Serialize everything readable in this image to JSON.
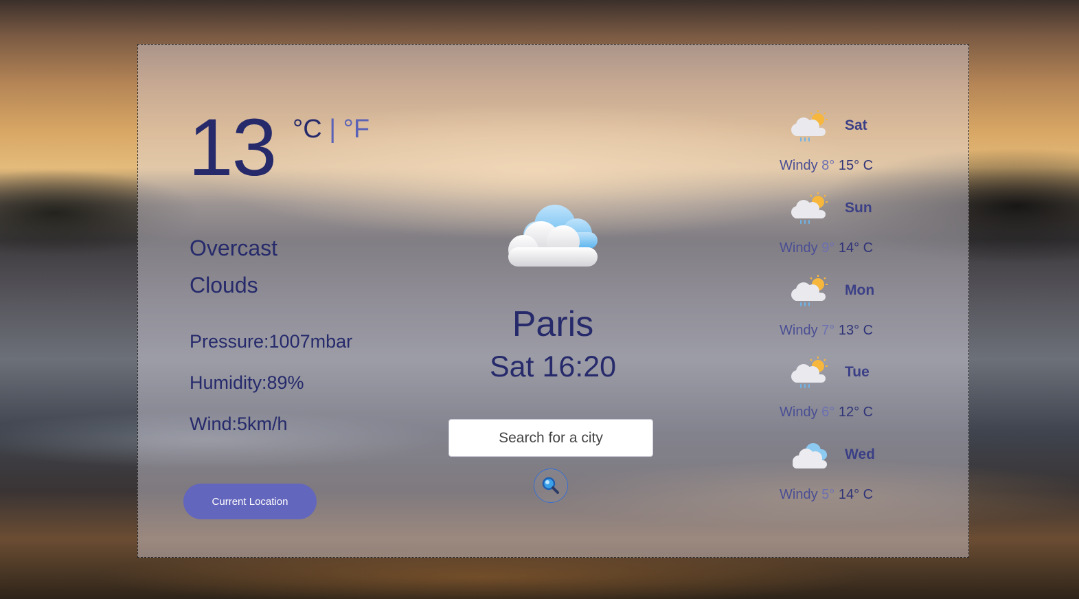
{
  "current": {
    "temperature": "13",
    "unit_celsius": "°C",
    "unit_separator": "|",
    "unit_fahrenheit": "°F",
    "description_line1": "Overcast",
    "description_line2": "Clouds",
    "pressure": "Pressure:1007mbar",
    "humidity": "Humidity:89%",
    "wind": "Wind:5km/h",
    "icon": "cloud-icon"
  },
  "location_button": {
    "label": "Current Location"
  },
  "city": {
    "name": "Paris",
    "datetime": "Sat 16:20"
  },
  "search": {
    "placeholder": "Search for a city",
    "value": "",
    "button_icon": "search-icon"
  },
  "forecast": [
    {
      "day": "Sat",
      "condition": "Windy",
      "min": "8°",
      "max": "15° C",
      "icon": "sun-cloud-rain-icon"
    },
    {
      "day": "Sun",
      "condition": "Windy",
      "min": "9°",
      "max": "14° C",
      "icon": "sun-cloud-rain-icon"
    },
    {
      "day": "Mon",
      "condition": "Windy",
      "min": "7°",
      "max": "13° C",
      "icon": "sun-cloud-rain-icon"
    },
    {
      "day": "Tue",
      "condition": "Windy",
      "min": "6°",
      "max": "12° C",
      "icon": "sun-cloud-rain-icon"
    },
    {
      "day": "Wed",
      "condition": "Windy",
      "min": "5°",
      "max": "14° C",
      "icon": "cloud-icon"
    }
  ],
  "colors": {
    "text_primary": "#262a6b",
    "accent": "#6366bd",
    "search_border": "#3a6fd0"
  }
}
